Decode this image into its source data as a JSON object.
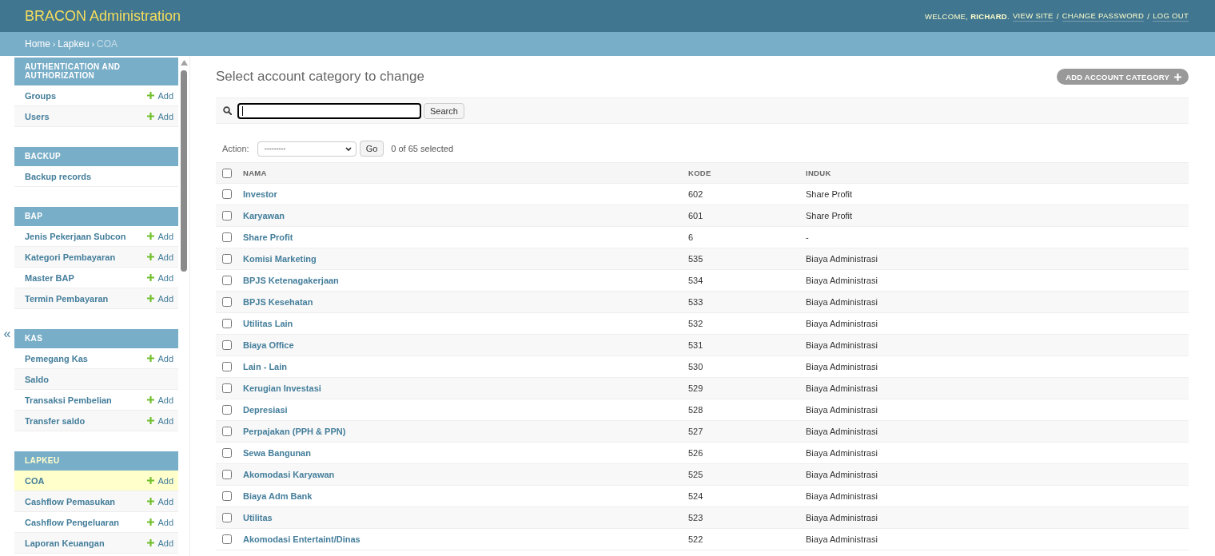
{
  "header": {
    "title": "BRACON Administration",
    "welcome": "WELCOME, **RICHARD**.",
    "links": [
      {
        "label": "VIEW SITE",
        "separator": "/"
      },
      {
        "label": "CHANGE PASSWORD",
        "separator": "/"
      },
      {
        "label": "LOG OUT"
      }
    ]
  },
  "breadcrumbs": {
    "items": [
      {
        "label": "Home",
        "current": false,
        "separator": "›"
      },
      {
        "label": "Lapkeu",
        "current": false,
        "separator": "›"
      },
      {
        "label": "COA",
        "current": true
      }
    ]
  },
  "sidebar": {
    "toggle": "«",
    "modules": [
      {
        "caption": "AUTHENTICATION AND AUTHORIZATION",
        "current": false,
        "items": [
          {
            "label": "Groups",
            "add": "Add",
            "selected": false
          },
          {
            "label": "Users",
            "add": "Add",
            "selected": false
          }
        ]
      },
      {
        "caption": "BACKUP",
        "current": false,
        "items": [
          {
            "label": "Backup records",
            "selected": false
          }
        ]
      },
      {
        "caption": "BAP",
        "current": false,
        "items": [
          {
            "label": "Jenis Pekerjaan Subcon",
            "add": "Add",
            "selected": false
          },
          {
            "label": "Kategori Pembayaran",
            "add": "Add",
            "selected": false
          },
          {
            "label": "Master BAP",
            "add": "Add",
            "selected": false
          },
          {
            "label": "Termin Pembayaran",
            "add": "Add",
            "selected": false
          }
        ]
      },
      {
        "caption": "KAS",
        "current": false,
        "items": [
          {
            "label": "Pemegang Kas",
            "add": "Add",
            "selected": false
          },
          {
            "label": "Saldo",
            "selected": false
          },
          {
            "label": "Transaksi Pembelian",
            "add": "Add",
            "selected": false
          },
          {
            "label": "Transfer saldo",
            "add": "Add",
            "selected": false
          }
        ]
      },
      {
        "caption": "LAPKEU",
        "current": true,
        "items": [
          {
            "label": "COA",
            "add": "Add",
            "selected": true
          },
          {
            "label": "Cashflow Pemasukan",
            "add": "Add",
            "selected": false
          },
          {
            "label": "Cashflow Pengeluaran",
            "add": "Add",
            "selected": false
          },
          {
            "label": "Laporan Keuangan",
            "add": "Add",
            "selected": false
          }
        ]
      }
    ]
  },
  "content": {
    "title": "Select account category to change",
    "add_button": "ADD ACCOUNT CATEGORY",
    "search": {
      "focused": true,
      "button": "Search"
    },
    "actions": {
      "label": "Action:",
      "value": "---------",
      "go": "Go",
      "counter": "0 of 65 selected"
    },
    "table": {
      "select_all_checked": false,
      "columns": [
        "NAMA",
        "KODE",
        "INDUK"
      ],
      "rows": [
        {
          "checked": false,
          "nama": "Investor",
          "kode": "602",
          "induk": "Share Profit"
        },
        {
          "checked": false,
          "nama": "Karyawan",
          "kode": "601",
          "induk": "Share Profit"
        },
        {
          "checked": false,
          "nama": "Share Profit",
          "kode": "6",
          "induk": "-"
        },
        {
          "checked": false,
          "nama": "Komisi Marketing",
          "kode": "535",
          "induk": "Biaya Administrasi"
        },
        {
          "checked": false,
          "nama": "BPJS Ketenagakerjaan",
          "kode": "534",
          "induk": "Biaya Administrasi"
        },
        {
          "checked": false,
          "nama": "BPJS Kesehatan",
          "kode": "533",
          "induk": "Biaya Administrasi"
        },
        {
          "checked": false,
          "nama": "Utilitas Lain",
          "kode": "532",
          "induk": "Biaya Administrasi"
        },
        {
          "checked": false,
          "nama": "Biaya Office",
          "kode": "531",
          "induk": "Biaya Administrasi"
        },
        {
          "checked": false,
          "nama": "Lain - Lain",
          "kode": "530",
          "induk": "Biaya Administrasi"
        },
        {
          "checked": false,
          "nama": "Kerugian Investasi",
          "kode": "529",
          "induk": "Biaya Administrasi"
        },
        {
          "checked": false,
          "nama": "Depresiasi",
          "kode": "528",
          "induk": "Biaya Administrasi"
        },
        {
          "checked": false,
          "nama": "Perpajakan (PPH & PPN)",
          "kode": "527",
          "induk": "Biaya Administrasi"
        },
        {
          "checked": false,
          "nama": "Sewa Bangunan",
          "kode": "526",
          "induk": "Biaya Administrasi"
        },
        {
          "checked": false,
          "nama": "Akomodasi Karyawan",
          "kode": "525",
          "induk": "Biaya Administrasi"
        },
        {
          "checked": false,
          "nama": "Biaya Adm Bank",
          "kode": "524",
          "induk": "Biaya Administrasi"
        },
        {
          "checked": false,
          "nama": "Utilitas",
          "kode": "523",
          "induk": "Biaya Administrasi"
        },
        {
          "checked": false,
          "nama": "Akomodasi Entertaint/Dinas",
          "kode": "522",
          "induk": "Biaya Administrasi"
        }
      ]
    }
  }
}
